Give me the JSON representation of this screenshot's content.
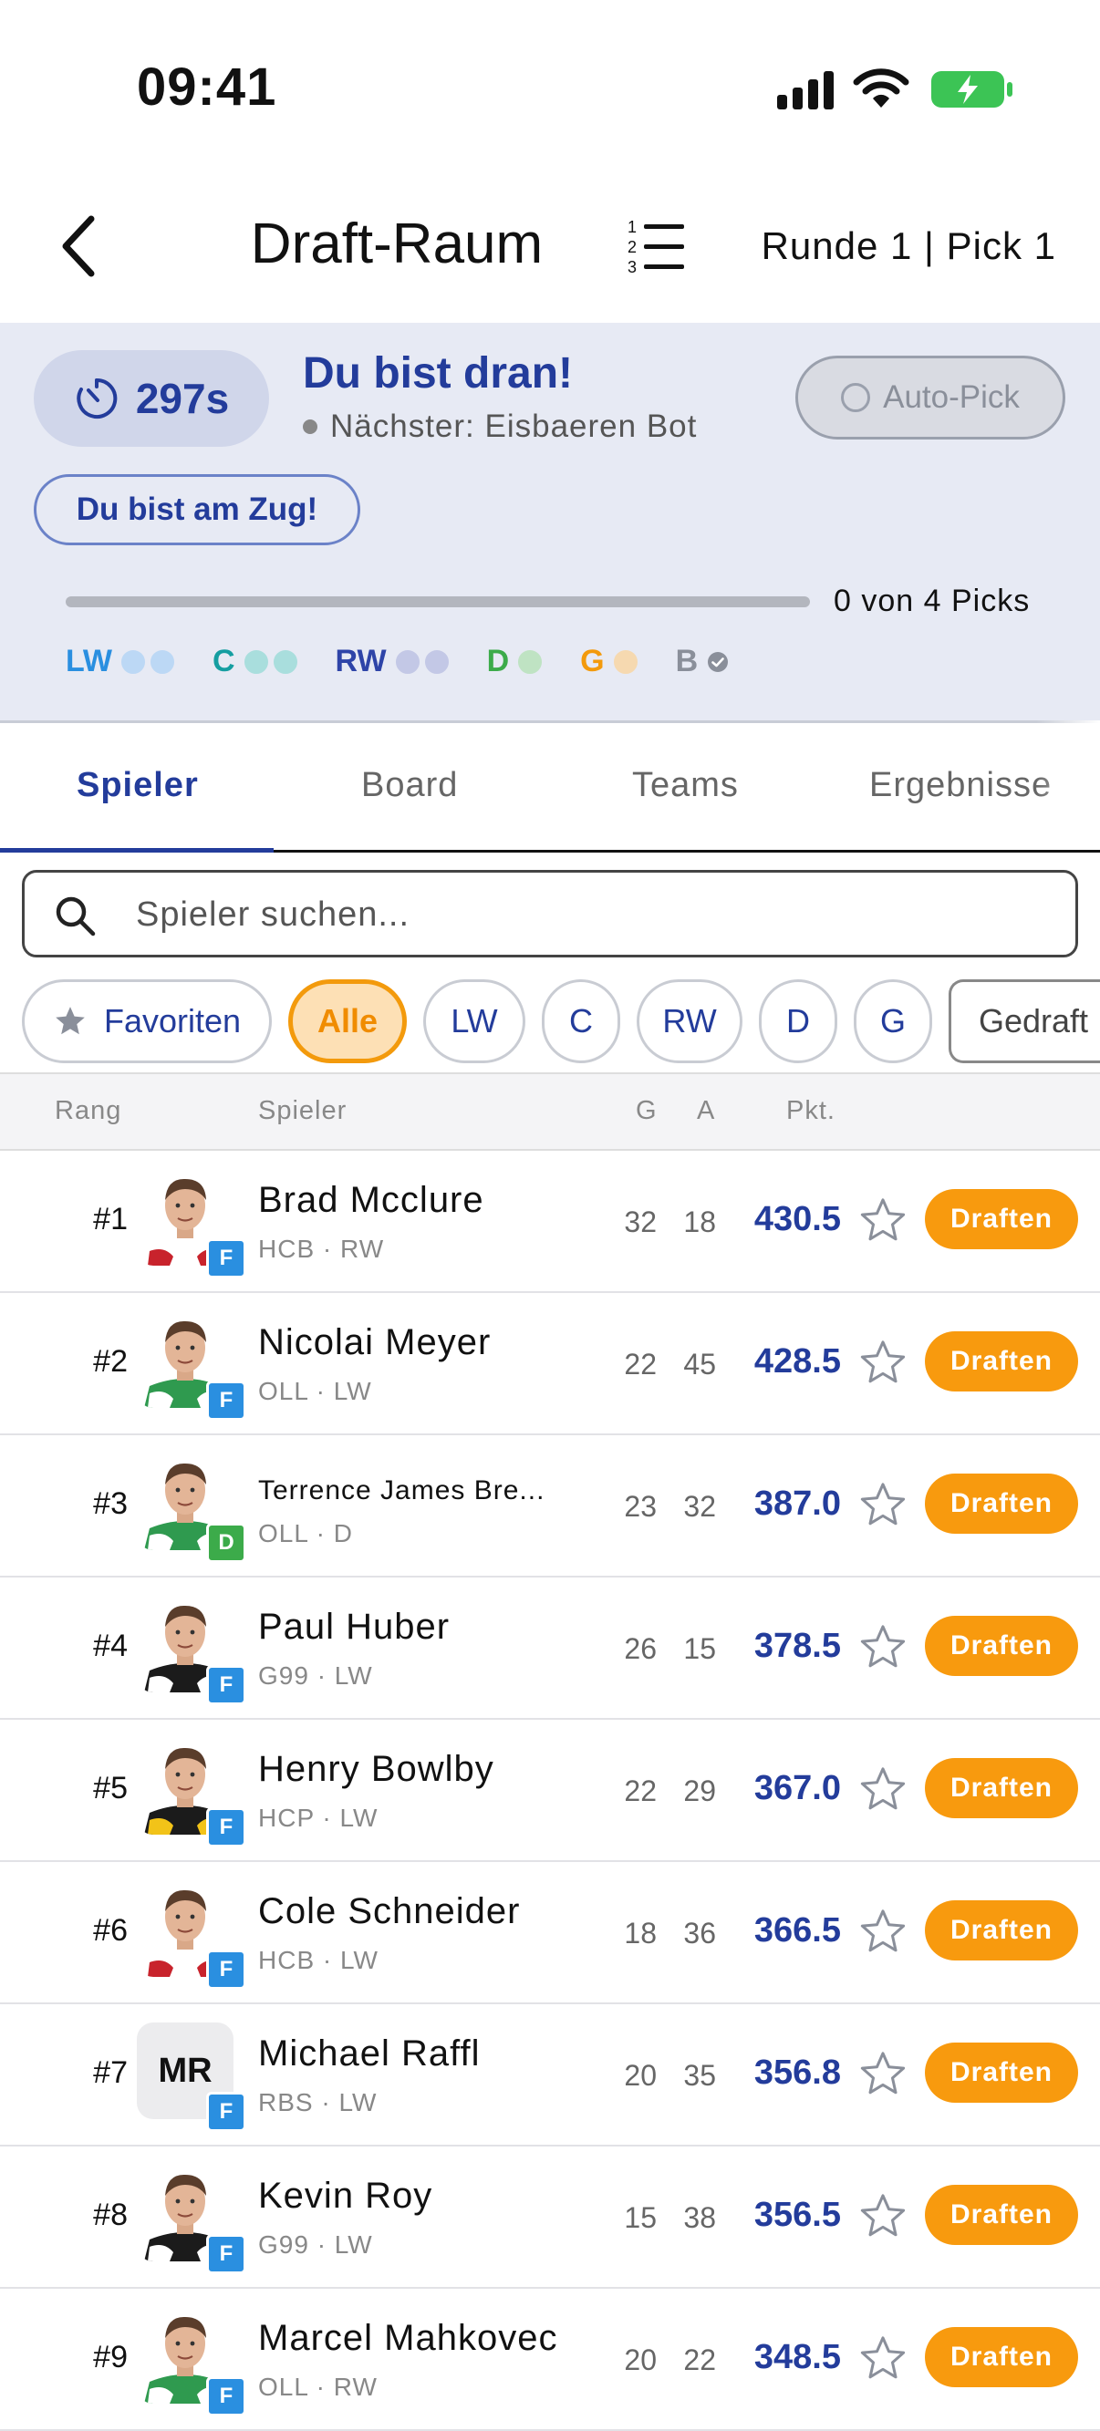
{
  "status_bar": {
    "time": "09:41"
  },
  "header": {
    "title": "Draft-Raum",
    "round_info": "Runde 1 | Pick 1"
  },
  "draft_panel": {
    "timer": "297s",
    "turn_title": "Du bist dran!",
    "next_label": "Nächster: Eisbaeren Bot",
    "auto_pick": "Auto-Pick",
    "your_move": "Du bist am Zug!",
    "progress": 0,
    "picks_label": "0 von 4 Picks",
    "positions": [
      {
        "label": "LW",
        "color": "#2a8fe0",
        "dot_color": "#bcd8f5",
        "slots": 2
      },
      {
        "label": "C",
        "color": "#159ea1",
        "dot_color": "#a9dedd",
        "slots": 2
      },
      {
        "label": "RW",
        "color": "#2e44a8",
        "dot_color": "#c3c8e6",
        "slots": 2
      },
      {
        "label": "D",
        "color": "#3cab4a",
        "dot_color": "#bfe3c3",
        "slots": 1
      },
      {
        "label": "G",
        "color": "#f39a0c",
        "dot_color": "#f6d9b0",
        "slots": 1
      },
      {
        "label": "B",
        "color": "#8a8f9a",
        "dot_color": "#8a8f9a",
        "slots": 1
      }
    ]
  },
  "tabs": [
    "Spieler",
    "Board",
    "Teams",
    "Ergebnisse"
  ],
  "search": {
    "placeholder": "Spieler suchen..."
  },
  "filters": {
    "favorites": "Favoriten",
    "all": "Alle",
    "positions": [
      "LW",
      "C",
      "RW",
      "D",
      "G"
    ],
    "drafted": "Gedraft"
  },
  "table_header": {
    "rank": "Rang",
    "player": "Spieler",
    "g": "G",
    "a": "A",
    "pts": "Pkt."
  },
  "draft_button": "Draften",
  "players": [
    {
      "rank": "#1",
      "name": "Brad Mcclure",
      "sub": "HCB · RW",
      "badge": "F",
      "g": "32",
      "a": "18",
      "pts": "430.5",
      "jersey": "#ffffff",
      "trim": "#c8232c"
    },
    {
      "rank": "#2",
      "name": "Nicolai Meyer",
      "sub": "OLL · LW",
      "badge": "F",
      "g": "22",
      "a": "45",
      "pts": "428.5",
      "jersey": "#2f9a4f",
      "trim": "#ffffff"
    },
    {
      "rank": "#3",
      "name": "Terrence James Bre...",
      "sub": "OLL · D",
      "badge": "D",
      "g": "23",
      "a": "32",
      "pts": "387.0",
      "jersey": "#2f9a4f",
      "trim": "#ffffff"
    },
    {
      "rank": "#4",
      "name": "Paul Huber",
      "sub": "G99 · LW",
      "badge": "F",
      "g": "26",
      "a": "15",
      "pts": "378.5",
      "jersey": "#1b1b1b",
      "trim": "#ffffff"
    },
    {
      "rank": "#5",
      "name": "Henry Bowlby",
      "sub": "HCP · LW",
      "badge": "F",
      "g": "22",
      "a": "29",
      "pts": "367.0",
      "jersey": "#1b1b1b",
      "trim": "#f2c318"
    },
    {
      "rank": "#6",
      "name": "Cole Schneider",
      "sub": "HCB · LW",
      "badge": "F",
      "g": "18",
      "a": "36",
      "pts": "366.5",
      "jersey": "#ffffff",
      "trim": "#c8232c"
    },
    {
      "rank": "#7",
      "name": "Michael Raffl",
      "sub": "RBS · LW",
      "badge": "F",
      "g": "20",
      "a": "35",
      "pts": "356.8",
      "initials": "MR"
    },
    {
      "rank": "#8",
      "name": "Kevin Roy",
      "sub": "G99 · LW",
      "badge": "F",
      "g": "15",
      "a": "38",
      "pts": "356.5",
      "jersey": "#1b1b1b",
      "trim": "#ffffff"
    },
    {
      "rank": "#9",
      "name": "Marcel Mahkovec",
      "sub": "OLL · RW",
      "badge": "F",
      "g": "20",
      "a": "22",
      "pts": "348.5",
      "jersey": "#2f9a4f",
      "trim": "#ffffff"
    }
  ]
}
